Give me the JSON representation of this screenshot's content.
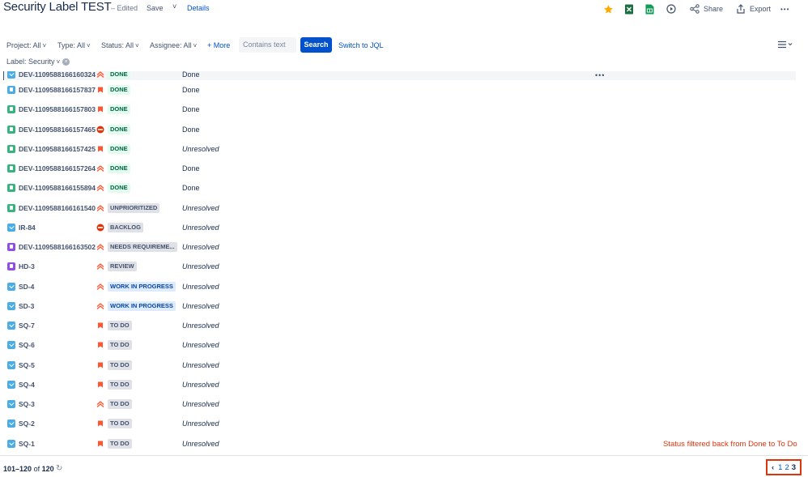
{
  "header": {
    "title": "Security Label TEST",
    "edited": "– Edited",
    "save": "Save",
    "save_caret": "˅",
    "details": "Details",
    "share": "Share",
    "export": "Export",
    "more": "•••"
  },
  "filters": {
    "project": "Project: All",
    "type": "Type: All",
    "status": "Status: All",
    "assignee": "Assignee: All",
    "more": "+ More",
    "contains_placeholder": "Contains text",
    "search": "Search",
    "switch_jql": "Switch to JQL",
    "label": "Label: Security",
    "caret": "˅"
  },
  "rows": [
    {
      "type": "task",
      "key": "DEV-1109588166160324",
      "prio": "highest",
      "status": "DONE",
      "st": "done",
      "resolution": "Done",
      "italic": false
    },
    {
      "type": "sub",
      "key": "DEV-1109588166157837",
      "prio": "high",
      "status": "DONE",
      "st": "done",
      "resolution": "Done",
      "italic": false
    },
    {
      "type": "story",
      "key": "DEV-1109588166157803",
      "prio": "high",
      "status": "DONE",
      "st": "done",
      "resolution": "Done",
      "italic": false
    },
    {
      "type": "story",
      "key": "DEV-1109588166157465",
      "prio": "blocker",
      "status": "DONE",
      "st": "done",
      "resolution": "Done",
      "italic": false
    },
    {
      "type": "story",
      "key": "DEV-1109588166157425",
      "prio": "high",
      "status": "DONE",
      "st": "done",
      "resolution": "Unresolved",
      "italic": true
    },
    {
      "type": "story",
      "key": "DEV-1109588166157264",
      "prio": "highest",
      "status": "DONE",
      "st": "done",
      "resolution": "Done",
      "italic": false
    },
    {
      "type": "story",
      "key": "DEV-1109588166155894",
      "prio": "highest",
      "status": "DONE",
      "st": "done",
      "resolution": "Done",
      "italic": false
    },
    {
      "type": "story",
      "key": "DEV-1109588166161540",
      "prio": "highest",
      "status": "UNPRIORITIZED",
      "st": "todo",
      "resolution": "Unresolved",
      "italic": true
    },
    {
      "type": "task",
      "key": "IR-84",
      "prio": "blocker",
      "status": "BACKLOG",
      "st": "todo",
      "resolution": "Unresolved",
      "italic": true
    },
    {
      "type": "epic",
      "key": "DEV-1109588166163502",
      "prio": "highest",
      "status": "NEEDS REQUIREME...",
      "st": "todo",
      "resolution": "Unresolved",
      "italic": true
    },
    {
      "type": "service",
      "key": "HD-3",
      "prio": "highest",
      "status": "REVIEW",
      "st": "todo",
      "resolution": "Unresolved",
      "italic": true
    },
    {
      "type": "task",
      "key": "SD-4",
      "prio": "highest",
      "status": "WORK IN PROGRESS",
      "st": "prog",
      "resolution": "Unresolved",
      "italic": true
    },
    {
      "type": "task",
      "key": "SD-3",
      "prio": "highest",
      "status": "WORK IN PROGRESS",
      "st": "prog",
      "resolution": "Unresolved",
      "italic": true
    },
    {
      "type": "task",
      "key": "SQ-7",
      "prio": "high",
      "status": "TO DO",
      "st": "todo",
      "resolution": "Unresolved",
      "italic": true
    },
    {
      "type": "task",
      "key": "SQ-6",
      "prio": "high",
      "status": "TO DO",
      "st": "todo",
      "resolution": "Unresolved",
      "italic": true
    },
    {
      "type": "task",
      "key": "SQ-5",
      "prio": "high",
      "status": "TO DO",
      "st": "todo",
      "resolution": "Unresolved",
      "italic": true
    },
    {
      "type": "task",
      "key": "SQ-4",
      "prio": "high",
      "status": "TO DO",
      "st": "todo",
      "resolution": "Unresolved",
      "italic": true
    },
    {
      "type": "task",
      "key": "SQ-3",
      "prio": "highest",
      "status": "TO DO",
      "st": "todo",
      "resolution": "Unresolved",
      "italic": true
    },
    {
      "type": "task",
      "key": "SQ-2",
      "prio": "high",
      "status": "TO DO",
      "st": "todo",
      "resolution": "Unresolved",
      "italic": true
    },
    {
      "type": "task",
      "key": "SQ-1",
      "prio": "high",
      "status": "TO DO",
      "st": "todo",
      "resolution": "Unresolved",
      "italic": true
    }
  ],
  "row_more": "•••",
  "annotation": "Status filtered back from Done to To Do",
  "footer": {
    "range": "101–120",
    "of": "of",
    "total": "120",
    "refresh": "↻",
    "prev": "‹",
    "pages": [
      "1",
      "2",
      "3"
    ],
    "current_page": "3"
  },
  "colors": {
    "accent": "#0052cc",
    "done_bg": "#e3fcef",
    "annotation": "#de350b",
    "priority": "#ff5630"
  },
  "icons": {
    "star": "star-icon",
    "excel": "excel-icon",
    "sheets": "google-sheets-icon",
    "play": "play-icon",
    "share": "share-icon",
    "export": "export-icon",
    "list_view": "list-view-icon",
    "refresh": "refresh-icon"
  }
}
